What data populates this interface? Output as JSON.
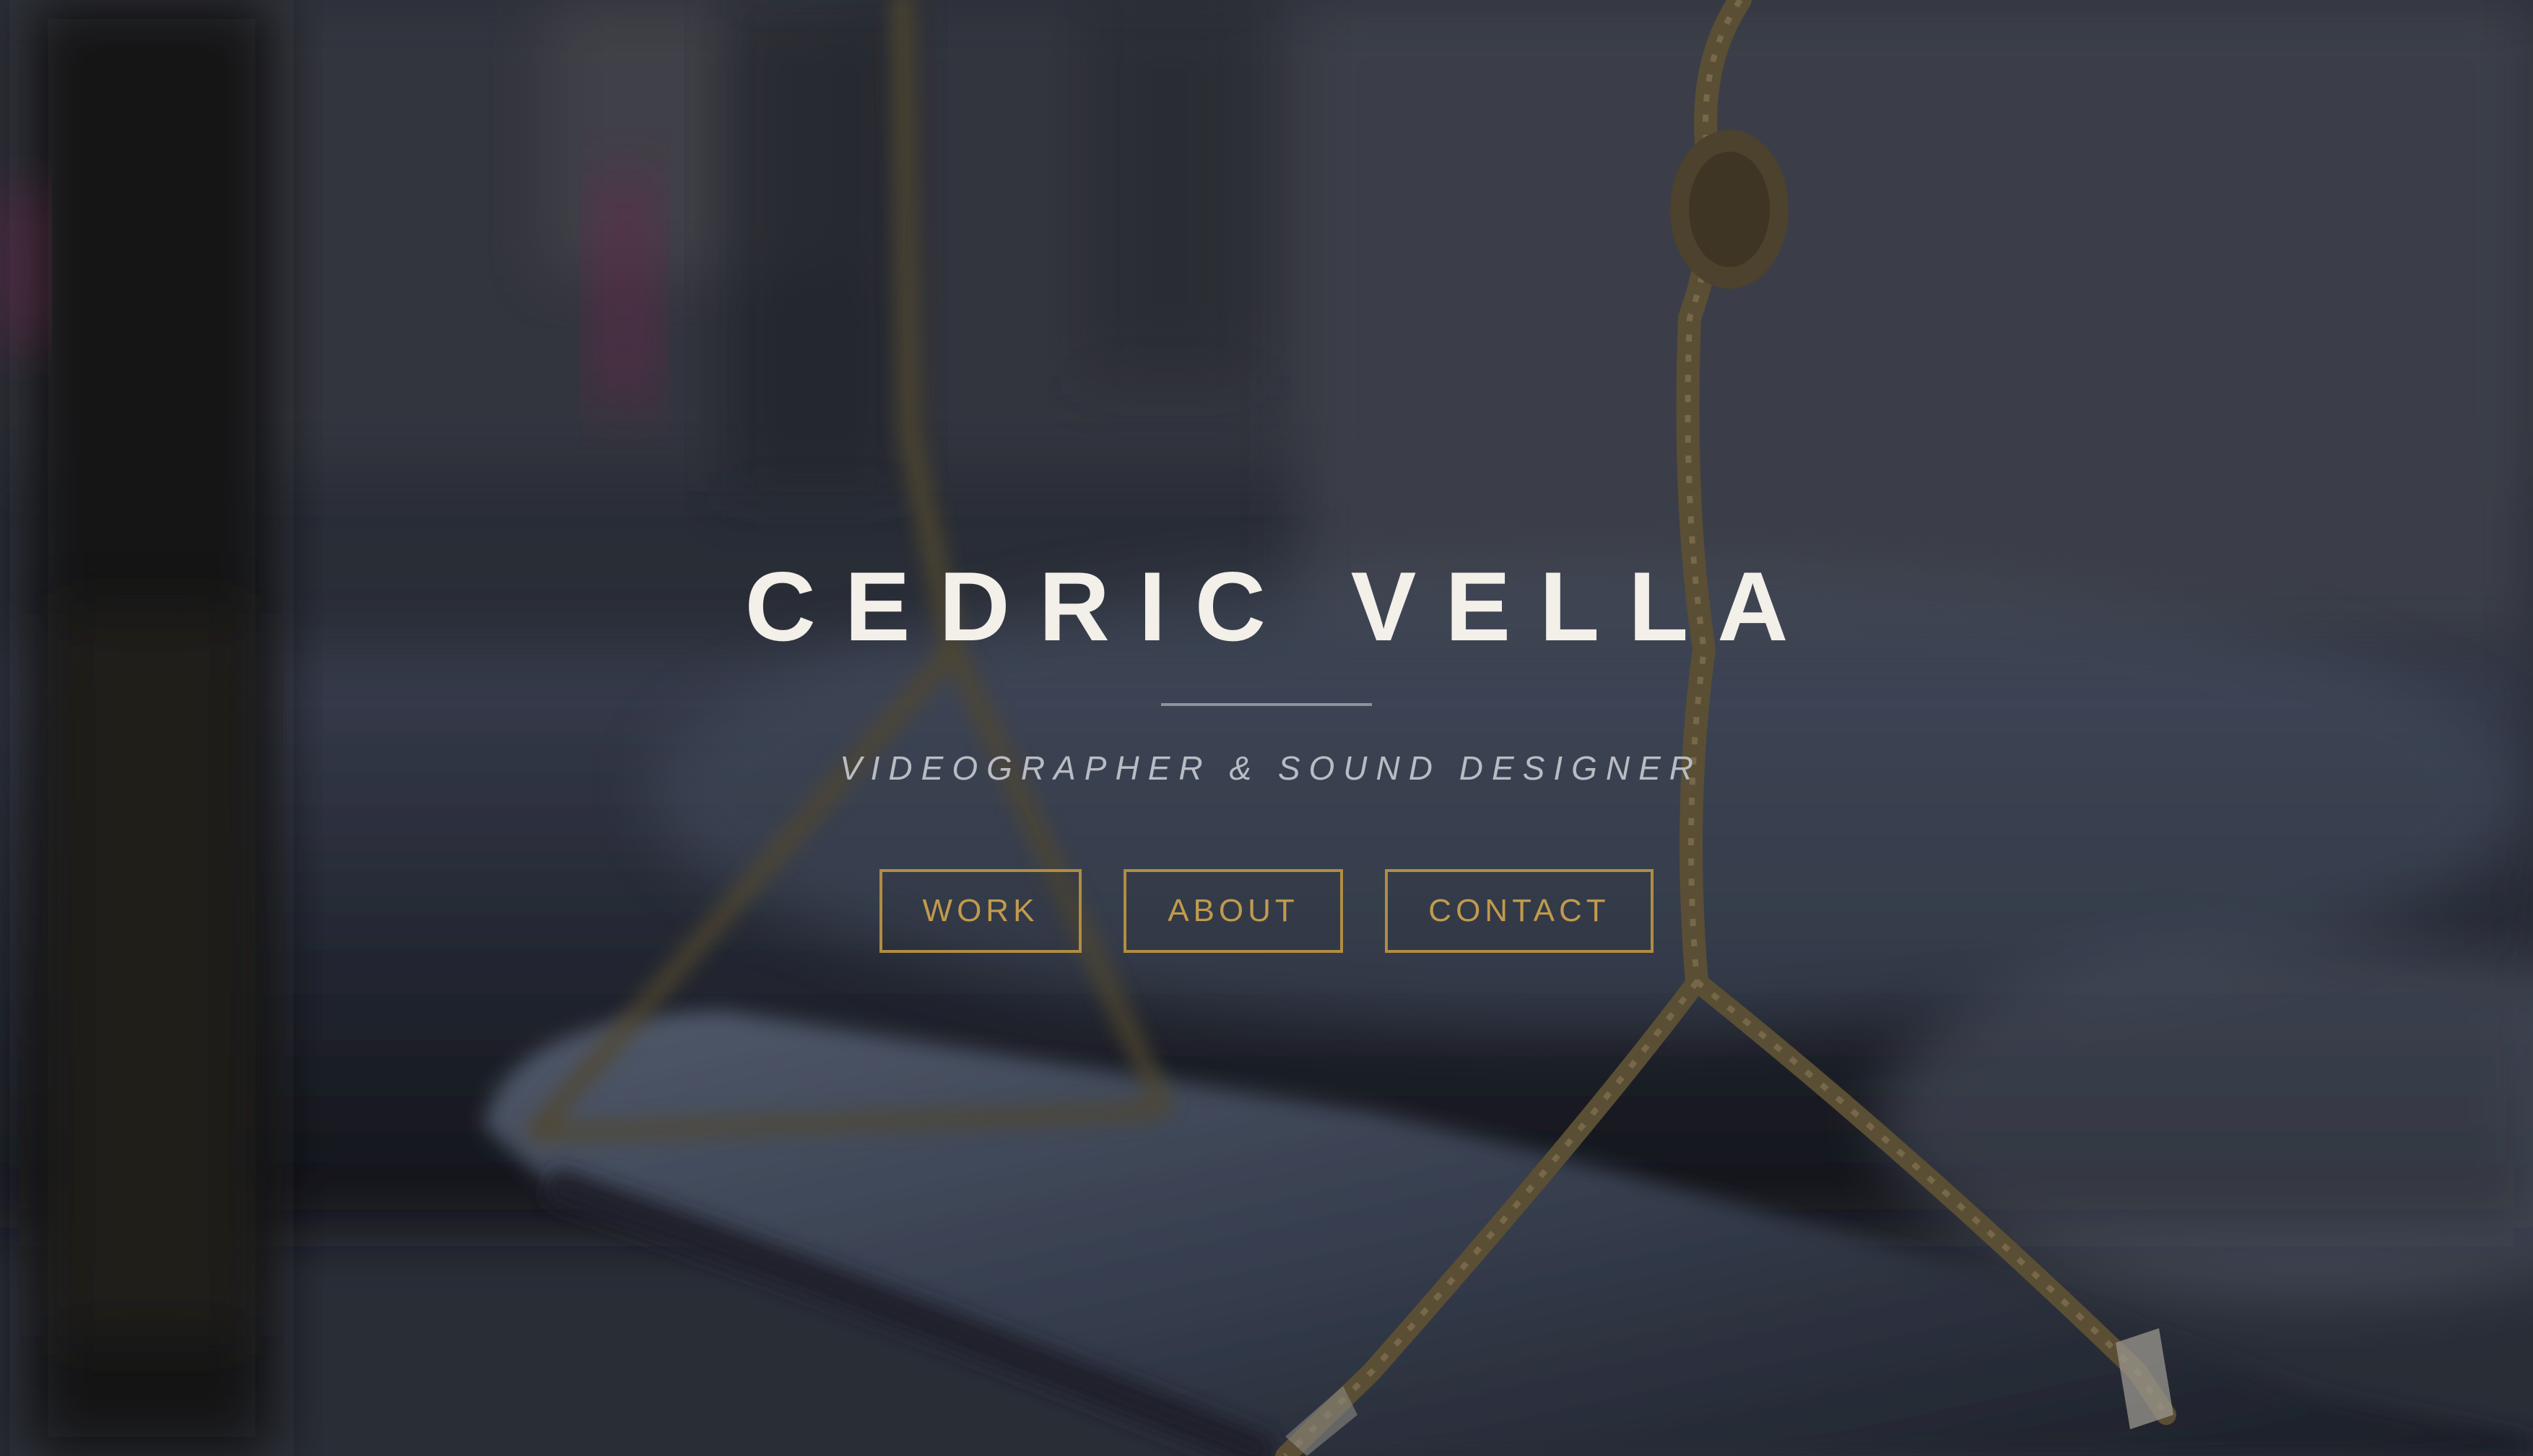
{
  "hero": {
    "title": "CEDRIC VELLA",
    "subtitle": "VIDEOGRAPHER & SOUND DESIGNER",
    "background_image": "blurred-street-swing-photo",
    "accent_color": "#b08d44",
    "title_color": "#f3efe9"
  },
  "nav": {
    "items": [
      {
        "label": "WORK"
      },
      {
        "label": "ABOUT"
      },
      {
        "label": "CONTACT"
      }
    ]
  }
}
